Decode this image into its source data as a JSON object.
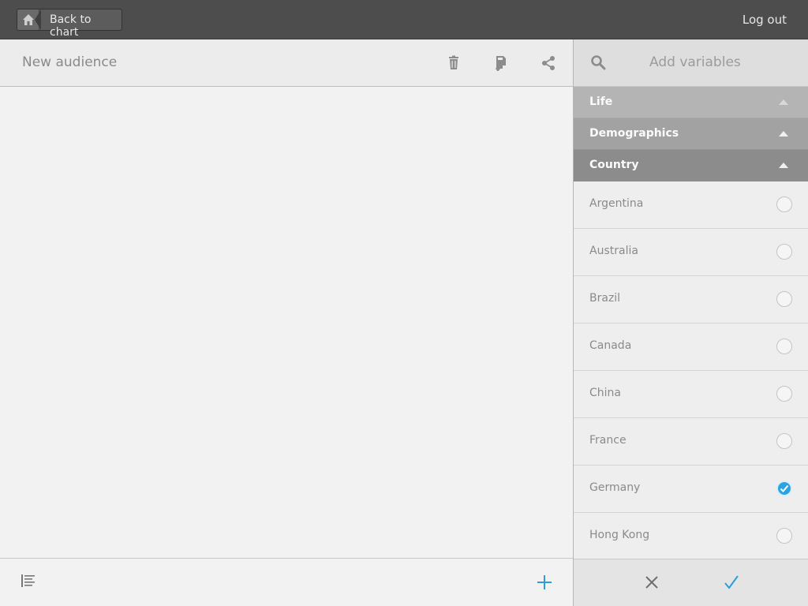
{
  "topbar": {
    "back_label": "Back to chart",
    "logout_label": "Log out"
  },
  "audience": {
    "title": "New audience",
    "header_icons": [
      "trash-icon",
      "save-icon",
      "share-icon"
    ],
    "footer_icons": [
      "list-icon",
      "plus-icon"
    ]
  },
  "variables": {
    "title": "Add variables",
    "sections": [
      {
        "label": "Life"
      },
      {
        "label": "Demographics"
      },
      {
        "label": "Country"
      }
    ],
    "countries": [
      {
        "label": "Argentina",
        "checked": false
      },
      {
        "label": "Australia",
        "checked": false
      },
      {
        "label": "Brazil",
        "checked": false
      },
      {
        "label": "Canada",
        "checked": false
      },
      {
        "label": "China",
        "checked": false
      },
      {
        "label": "France",
        "checked": false
      },
      {
        "label": "Germany",
        "checked": true
      },
      {
        "label": "Hong Kong",
        "checked": false
      }
    ],
    "footer_icons": [
      "close-icon",
      "check-icon"
    ]
  },
  "colors": {
    "topbar": "#4d4d4d",
    "accent": "#2aa4e0",
    "panel_bg": "#f2f2f2"
  }
}
